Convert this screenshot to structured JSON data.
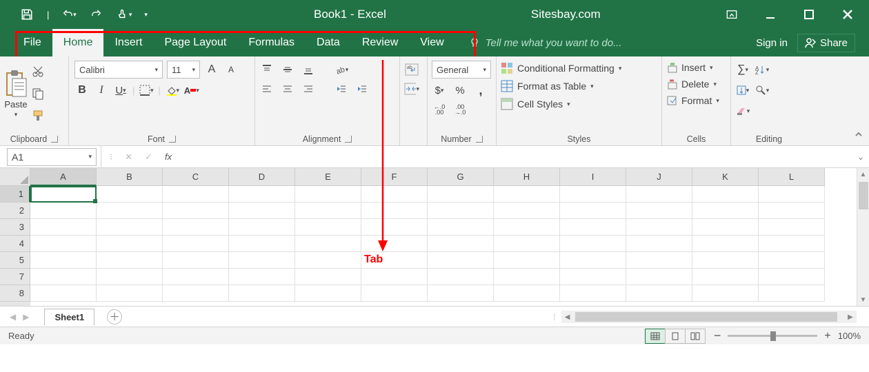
{
  "titlebar": {
    "title": "Book1 - Excel",
    "site": "Sitesbay.com"
  },
  "tabs": {
    "file": "File",
    "home": "Home",
    "insert": "Insert",
    "page_layout": "Page Layout",
    "formulas": "Formulas",
    "data": "Data",
    "review": "Review",
    "view": "View"
  },
  "tellme": "Tell me what you want to do...",
  "signin": "Sign in",
  "share": "Share",
  "ribbon": {
    "clipboard": {
      "label": "Clipboard",
      "paste": "Paste"
    },
    "font": {
      "label": "Font",
      "name": "Calibri",
      "size": "11",
      "bold": "B",
      "italic": "I",
      "underline": "U",
      "increase": "A",
      "decrease": "A"
    },
    "alignment": {
      "label": "Alignment"
    },
    "number": {
      "label": "Number",
      "format": "General",
      "dec_inc": ".0",
      "dec_dec": ".00",
      "dec_inc2": ".00",
      "dec_dec2": ".0"
    },
    "styles": {
      "label": "Styles",
      "cond": "Conditional Formatting",
      "table": "Format as Table",
      "cell": "Cell Styles"
    },
    "cells": {
      "label": "Cells",
      "insert": "Insert",
      "delete": "Delete",
      "format": "Format"
    },
    "editing": {
      "label": "Editing"
    }
  },
  "namebox": "A1",
  "fx": "fx",
  "columns": [
    "A",
    "B",
    "C",
    "D",
    "E",
    "F",
    "G",
    "H",
    "I",
    "J",
    "K",
    "L"
  ],
  "rows": [
    "1",
    "2",
    "3",
    "4",
    "5",
    "7",
    "8"
  ],
  "sheet": "Sheet1",
  "status": {
    "ready": "Ready",
    "zoom": "100%"
  },
  "annotation": "Tab"
}
